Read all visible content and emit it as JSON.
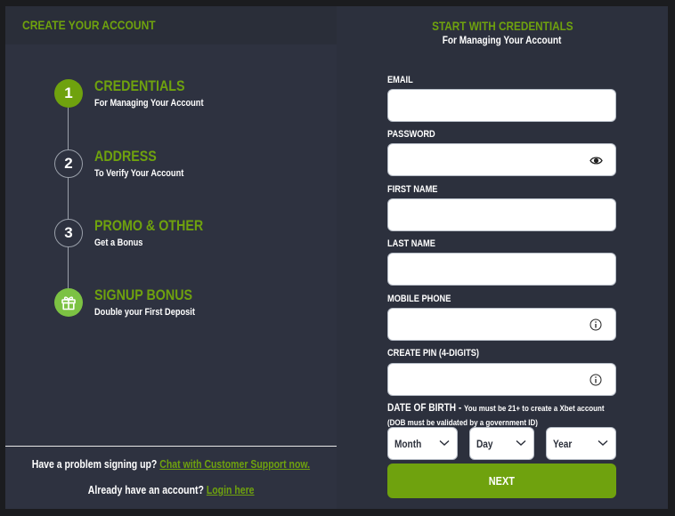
{
  "left": {
    "header_title": "CREATE YOUR ACCOUNT",
    "steps": [
      {
        "number": "1",
        "title": "CREDENTIALS",
        "subtitle": "For Managing Your Account",
        "state": "active"
      },
      {
        "number": "2",
        "title": "ADDRESS",
        "subtitle": "To Verify Your Account",
        "state": "pending"
      },
      {
        "number": "3",
        "title": "PROMO & OTHER",
        "subtitle": "Get a Bonus",
        "state": "pending"
      },
      {
        "number": "",
        "icon": "gift-icon",
        "title": "SIGNUP BONUS",
        "subtitle": "Double your First Deposit",
        "state": "bonus"
      }
    ],
    "footer": {
      "problem_text": "Have a problem signing up?",
      "support_link": "Chat with Customer Support now.",
      "account_text": "Already have an account?",
      "login_link": "Login here"
    }
  },
  "right": {
    "title": "START WITH CREDENTIALS",
    "subtitle": "For Managing Your Account",
    "fields": {
      "email": {
        "label": "EMAIL",
        "value": "",
        "placeholder": ""
      },
      "password": {
        "label": "PASSWORD",
        "value": "",
        "placeholder": "",
        "icon": "eye-icon"
      },
      "first_name": {
        "label": "FIRST NAME",
        "value": "",
        "placeholder": ""
      },
      "last_name": {
        "label": "LAST NAME",
        "value": "",
        "placeholder": ""
      },
      "mobile_phone": {
        "label": "MOBILE PHONE",
        "value": "",
        "placeholder": "",
        "icon": "info-icon"
      },
      "pin": {
        "label": "CREATE PIN (4-DIGITS)",
        "value": "",
        "placeholder": "",
        "icon": "info-icon"
      }
    },
    "dob": {
      "label": "DATE OF BIRTH - ",
      "note": "You must be 21+ to create a Xbet account (DOB must be validated by a government ID)",
      "month": "Month",
      "day": "Day",
      "year": "Year"
    },
    "next_label": "NEXT"
  },
  "colors": {
    "accent": "#6fa20e",
    "bonus": "#7cc243",
    "panel": "#2e3240",
    "background": "#1b1c1f"
  }
}
